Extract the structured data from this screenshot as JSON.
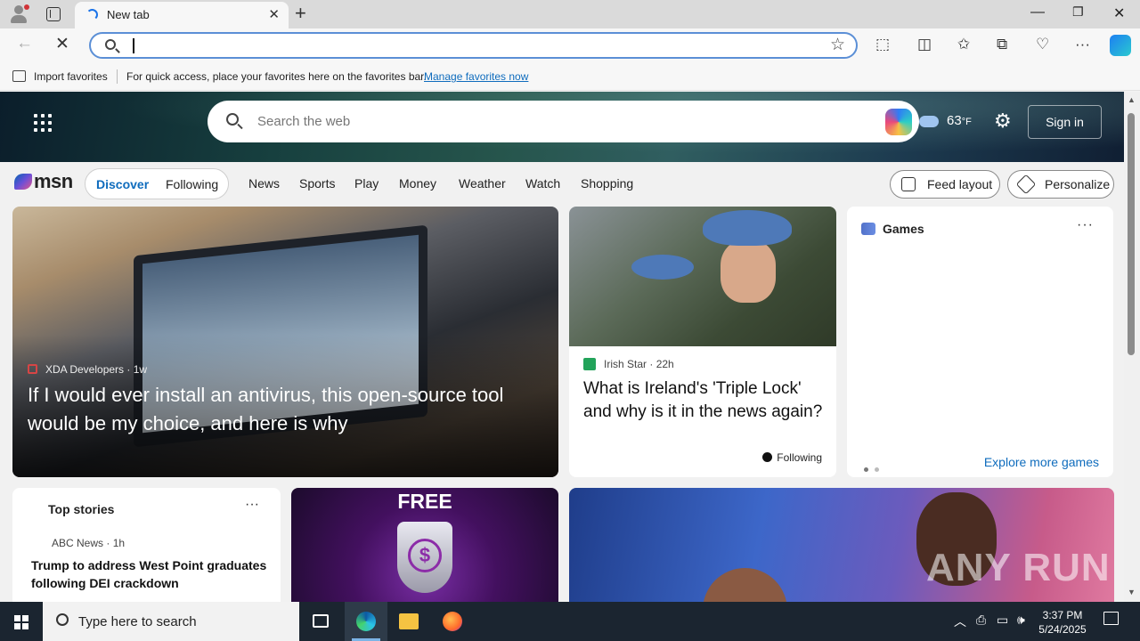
{
  "browser": {
    "tab_title": "New tab",
    "favorites_bar": {
      "import_label": "Import favorites",
      "message": "For quick access, place your favorites here on the favorites bar.",
      "manage_link": "Manage favorites now"
    }
  },
  "msn": {
    "search_placeholder": "Search the web",
    "weather_temp": "63",
    "weather_unit": "°F",
    "sign_in": "Sign in",
    "logo": "msn",
    "feed_tabs": [
      "Discover",
      "Following"
    ],
    "nav": [
      "News",
      "Sports",
      "Play",
      "Money",
      "Weather",
      "Watch",
      "Shopping"
    ],
    "feed_layout": "Feed layout",
    "personalize": "Personalize",
    "hero": {
      "source": "XDA Developers",
      "age": "1w",
      "title": "If I would ever install an antivirus, this open-source tool would be my choice, and here is why"
    },
    "ireland": {
      "source": "Irish Star",
      "age": "22h",
      "title": "What is Ireland's 'Triple Lock' and why is it in the news again?",
      "follow_label": "Following"
    },
    "games": {
      "title": "Games",
      "explore": "Explore more games"
    },
    "top_stories": {
      "title": "Top stories",
      "source": "ABC News",
      "age": "1h",
      "headline": "Trump to address West Point graduates following DEI crackdown"
    },
    "promo": {
      "word": "FREE"
    },
    "watermark": "ANY RUN"
  },
  "taskbar": {
    "search_placeholder": "Type here to search",
    "time": "3:37 PM",
    "date": "5/24/2025"
  }
}
